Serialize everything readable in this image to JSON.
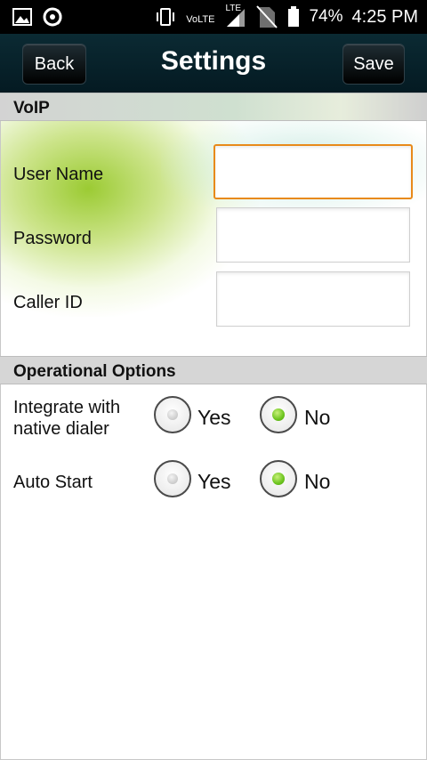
{
  "status_bar": {
    "volte": "VoLTE",
    "lte": "LTE",
    "battery": "74%",
    "time": "4:25 PM",
    "icons": [
      "gallery-icon",
      "notification-icon",
      "vibrate-icon",
      "signal-icon",
      "no-sim-icon",
      "battery-icon"
    ]
  },
  "header": {
    "title": "Settings",
    "back_label": "Back",
    "save_label": "Save"
  },
  "voip": {
    "section_title": "VoIP",
    "fields": [
      {
        "label": "User Name",
        "value": "",
        "focused": true
      },
      {
        "label": "Password",
        "value": ""
      },
      {
        "label": "Caller ID",
        "value": ""
      }
    ]
  },
  "operational": {
    "section_title": "Operational Options",
    "options": [
      {
        "label_line1": "Integrate with",
        "label_line2": "native dialer",
        "yes": "Yes",
        "no": "No",
        "selected": "No"
      },
      {
        "label": "Auto Start",
        "yes": "Yes",
        "no": "No",
        "selected": "No"
      }
    ]
  },
  "colors": {
    "focus_border": "#e88a1a",
    "radio_selected": "#6cc41e",
    "header_bg": "#0b2a33"
  }
}
